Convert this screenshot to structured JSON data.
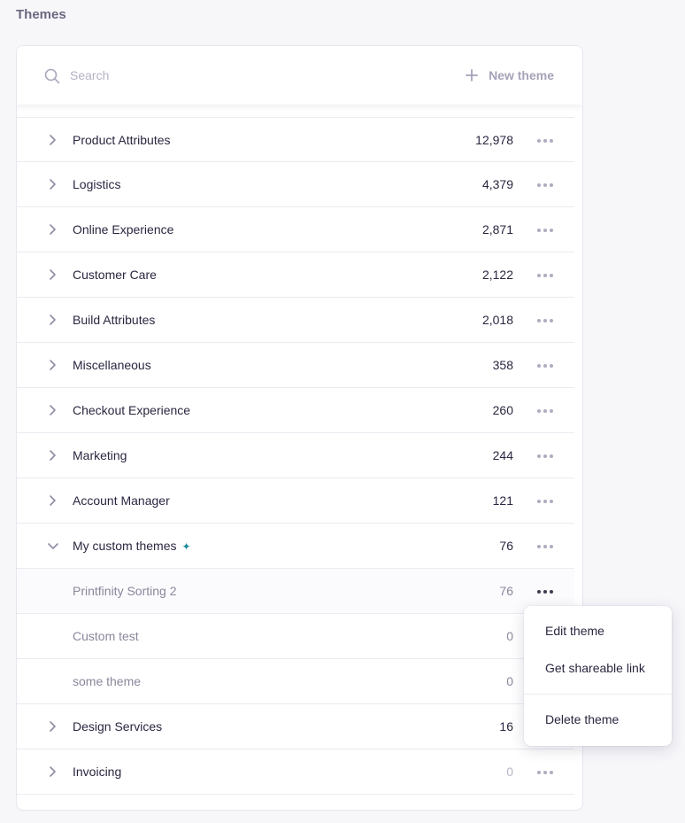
{
  "page": {
    "title": "Themes"
  },
  "search": {
    "placeholder": "Search",
    "icon": "search-icon"
  },
  "actions": {
    "new_theme_label": "New theme",
    "icon": "plus-icon"
  },
  "themes": [
    {
      "name": "Product Attributes",
      "count": "12,978",
      "expanded": false
    },
    {
      "name": "Logistics",
      "count": "4,379",
      "expanded": false
    },
    {
      "name": "Online Experience",
      "count": "2,871",
      "expanded": false
    },
    {
      "name": "Customer Care",
      "count": "2,122",
      "expanded": false
    },
    {
      "name": "Build Attributes",
      "count": "2,018",
      "expanded": false
    },
    {
      "name": "Miscellaneous",
      "count": "358",
      "expanded": false
    },
    {
      "name": "Checkout Experience",
      "count": "260",
      "expanded": false
    },
    {
      "name": "Marketing",
      "count": "244",
      "expanded": false
    },
    {
      "name": "Account Manager",
      "count": "121",
      "expanded": false
    },
    {
      "name": "My custom themes",
      "count": "76",
      "expanded": true,
      "badge_icon": "sparkle-icon",
      "children": [
        {
          "name": "Printfinity Sorting 2",
          "count": "76",
          "menu_open": true
        },
        {
          "name": "Custom test",
          "count": "0"
        },
        {
          "name": "some theme",
          "count": "0"
        }
      ]
    },
    {
      "name": "Design Services",
      "count": "16",
      "expanded": false
    },
    {
      "name": "Invoicing",
      "count": "0",
      "expanded": false
    }
  ],
  "context_menu": {
    "items": [
      "Edit theme",
      "Get shareable link",
      "Delete theme"
    ]
  },
  "colors": {
    "accent": "#1d8f9e",
    "text": "#2a2740",
    "muted": "#8a879c"
  }
}
